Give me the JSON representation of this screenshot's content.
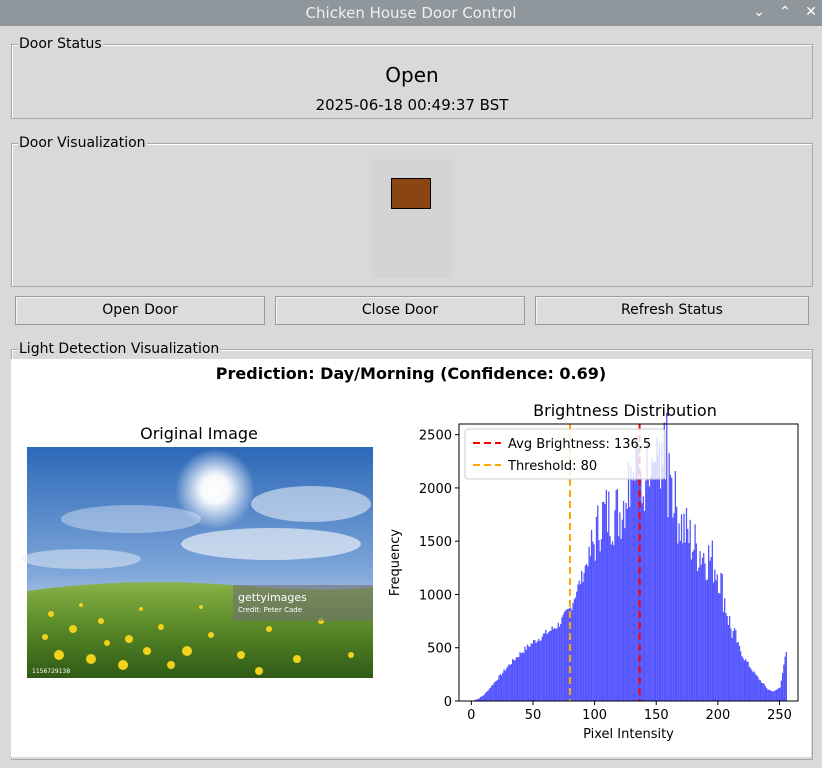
{
  "window": {
    "title": "Chicken House Door Control"
  },
  "door_status": {
    "legend": "Door Status",
    "state": "Open",
    "timestamp": "2025-06-18 00:49:37 BST"
  },
  "door_visualization": {
    "legend": "Door Visualization",
    "door_color": "#8b4513"
  },
  "buttons": {
    "open": "Open Door",
    "close": "Close Door",
    "refresh": "Refresh Status"
  },
  "light_detection": {
    "legend": "Light Detection Visualization",
    "suptitle": "Prediction: Day/Morning (Confidence: 0.69)",
    "image_title": "Original Image",
    "watermark": {
      "brand": "gettyimages",
      "credit": "Credit: Peter Cade",
      "id": "1156729138"
    }
  },
  "chart_data": {
    "type": "bar",
    "title": "Brightness Distribution",
    "xlabel": "Pixel Intensity",
    "ylabel": "Frequency",
    "xlim": [
      -10,
      265
    ],
    "ylim": [
      0,
      2600
    ],
    "xticks": [
      0,
      50,
      100,
      150,
      200,
      250
    ],
    "yticks": [
      0,
      500,
      1000,
      1500,
      2000,
      2500
    ],
    "bar_color": "#4b4bff",
    "legend_position": "upper-left",
    "legend": [
      {
        "label": "Avg Brightness: 136.5",
        "color": "#ff0000",
        "value": 136.5
      },
      {
        "label": "Threshold: 80",
        "color": "#ffa500",
        "value": 80
      }
    ],
    "histogram_profile": {
      "x": [
        0,
        5,
        10,
        20,
        30,
        40,
        50,
        60,
        70,
        80,
        85,
        90,
        100,
        105,
        110,
        120,
        130,
        135,
        140,
        145,
        150,
        155,
        160,
        170,
        180,
        190,
        195,
        200,
        210,
        220,
        230,
        240,
        245,
        250,
        253,
        255
      ],
      "y": [
        0,
        20,
        60,
        200,
        340,
        460,
        560,
        640,
        720,
        880,
        1050,
        1200,
        1560,
        1780,
        1800,
        1820,
        2200,
        2300,
        2200,
        2050,
        2000,
        2150,
        2100,
        1700,
        1500,
        1400,
        1350,
        1250,
        700,
        420,
        250,
        110,
        90,
        130,
        350,
        450
      ]
    }
  }
}
